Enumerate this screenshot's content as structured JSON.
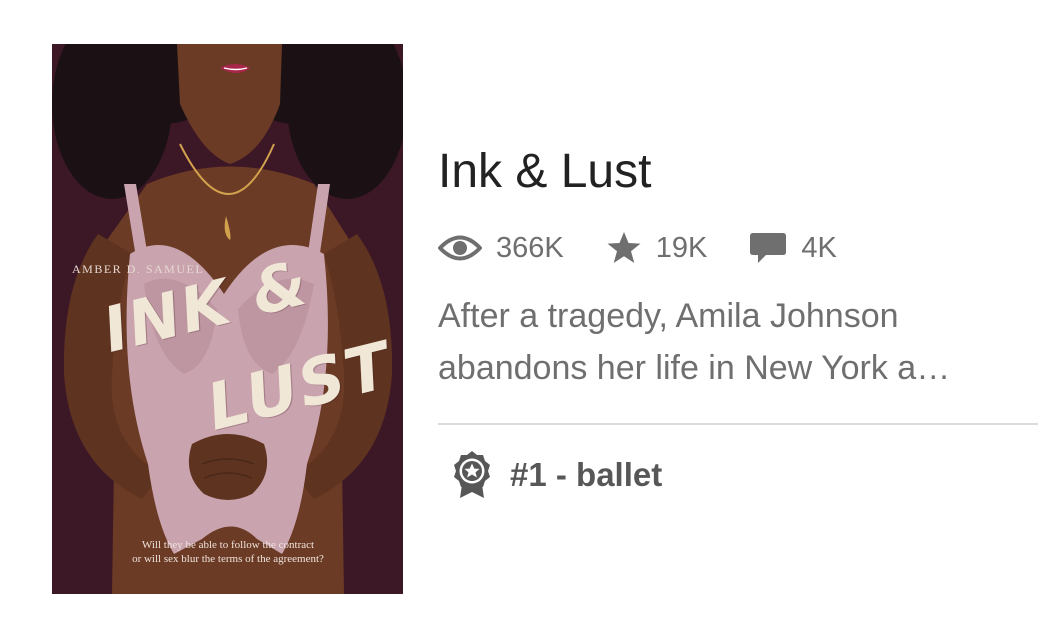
{
  "story": {
    "title": "Ink & Lust",
    "stats": {
      "reads": "366K",
      "votes": "19K",
      "comments": "4K"
    },
    "description_line1": "After a tragedy, Amila Johnson",
    "description_line2": "abandons her life in New York a…",
    "rank_label": "#1 - ballet"
  },
  "cover": {
    "author": "AMBER D. SAMUEL",
    "title_line1": "INK &",
    "title_line2": "LUST",
    "tagline_line1": "Will they be able to follow the contract",
    "tagline_line2": "or will sex blur the terms of the agreement?"
  },
  "colors": {
    "cover_background": "#3c1726",
    "skin": "#6b3b25",
    "lingerie": "#c9a3ae",
    "title_text": "#222222",
    "secondary_text": "#6f6f6f",
    "divider": "#dcdcdc"
  },
  "icons": {
    "reads": "eye-icon",
    "votes": "star-icon",
    "comments": "comment-icon",
    "rank": "award-ribbon-icon"
  }
}
